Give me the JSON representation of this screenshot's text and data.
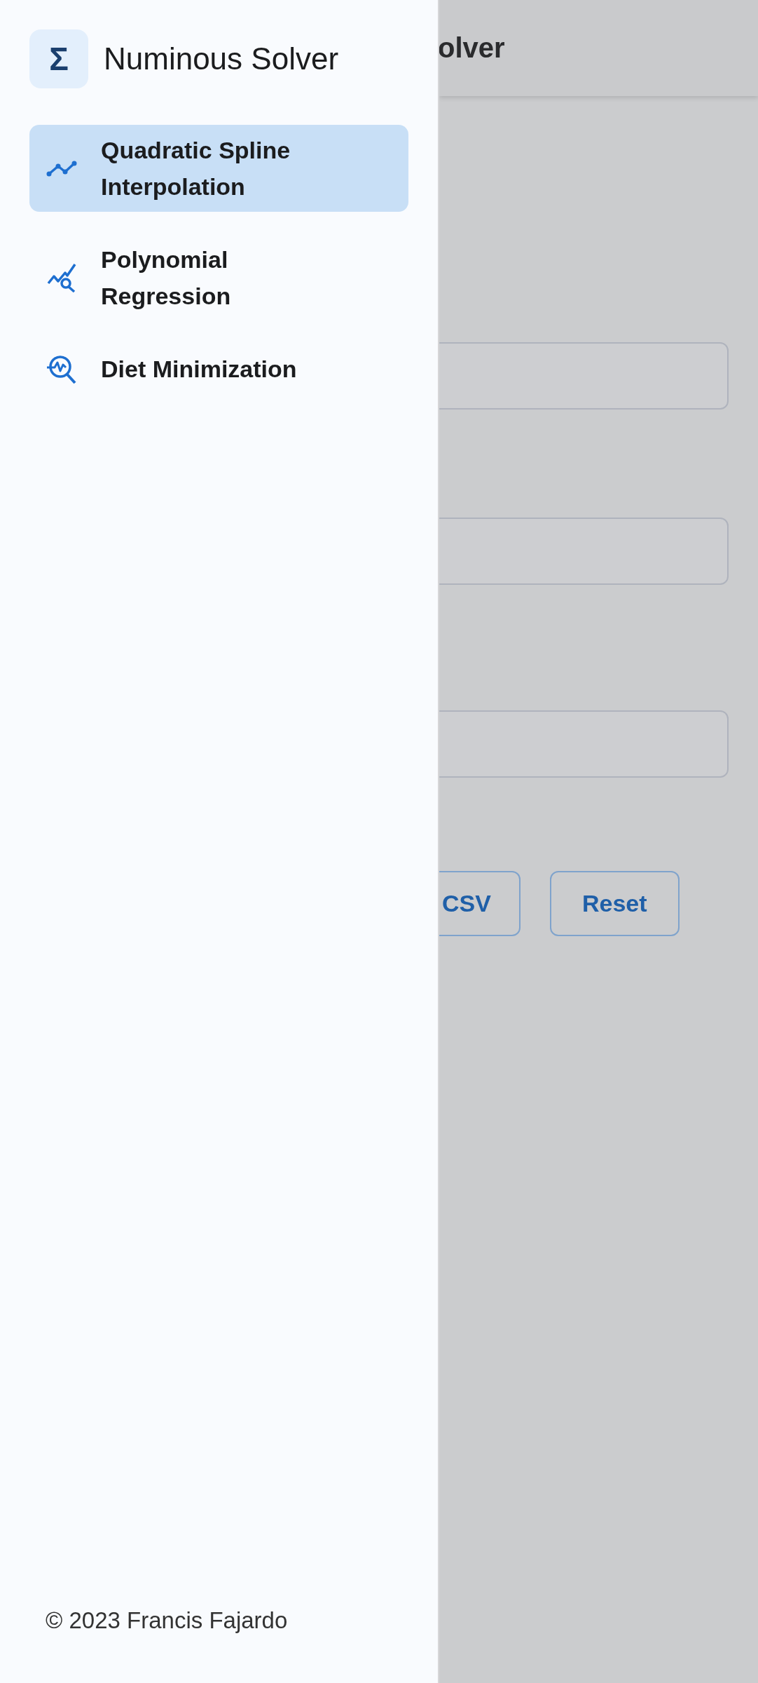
{
  "sidebar": {
    "logo": "Σ",
    "title": "Numinous Solver",
    "items": [
      {
        "label": "Quadratic Spline Interpolation",
        "kind": "spline",
        "selected": true
      },
      {
        "label": "Polynomial Regression",
        "kind": "regression",
        "selected": false
      },
      {
        "label": "Diet Minimization",
        "kind": "diet",
        "selected": false
      }
    ],
    "footer": "© 2023 Francis Fajardo"
  },
  "main": {
    "header_title": "olver",
    "fields": [
      {
        "kind": "text"
      },
      {
        "kind": "text"
      },
      {
        "kind": "text"
      }
    ],
    "buttons": [
      "CSV",
      "Reset"
    ]
  }
}
